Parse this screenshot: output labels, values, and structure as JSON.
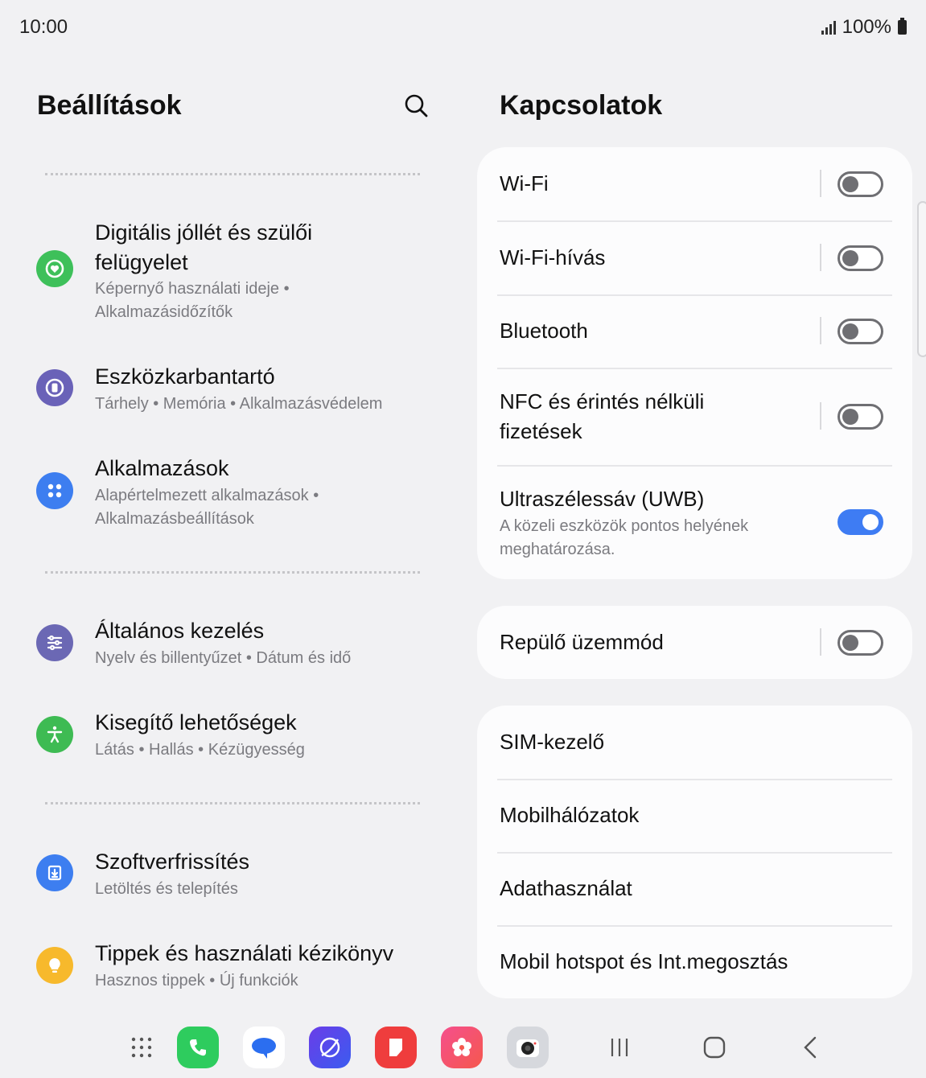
{
  "status": {
    "time": "10:00",
    "battery": "100%"
  },
  "left": {
    "title": "Beállítások",
    "items": [
      {
        "title_line1": "Digitális jóllét és szülői",
        "title_line2": "felügyelet",
        "sub_line1": "Képernyő használati ideje  •",
        "sub_line2": "Alkalmazásidőzítők",
        "icon": "heart-in-circle-icon",
        "color": "#3ec05a"
      },
      {
        "title": "Eszközkarbantartó",
        "sub": "Tárhely  •  Memória  •  Alkalmazásvédelem",
        "icon": "device-care-icon",
        "color": "#6a62b8"
      },
      {
        "title": "Alkalmazások",
        "sub_line1": "Alapértelmezett alkalmazások  •",
        "sub_line2": "Alkalmazásbeállítások",
        "icon": "apps-grid-icon",
        "color": "#3d7ef0"
      },
      {
        "title": "Általános kezelés",
        "sub": "Nyelv és billentyűzet  •  Dátum és idő",
        "icon": "sliders-icon",
        "color": "#6b68b4"
      },
      {
        "title": "Kisegítő lehetőségek",
        "sub": "Látás  •  Hallás  •  Kézügyesség",
        "icon": "accessibility-icon",
        "color": "#3ebb53"
      },
      {
        "title": "Szoftverfrissítés",
        "sub": "Letöltés és telepítés",
        "icon": "download-icon",
        "color": "#3d7ef0"
      },
      {
        "title": "Tippek és használati kézikönyv",
        "sub": "Hasznos tippek  •  Új funkciók",
        "icon": "lightbulb-icon",
        "color": "#f7b92c"
      }
    ]
  },
  "right": {
    "title": "Kapcsolatok",
    "wifi": {
      "label": "Wi-Fi",
      "on": false
    },
    "wifi_calling": {
      "label": "Wi-Fi-hívás",
      "on": false
    },
    "bluetooth": {
      "label": "Bluetooth",
      "on": false
    },
    "nfc": {
      "label_line1": "NFC és érintés nélküli",
      "label_line2": "fizetések",
      "on": false
    },
    "uwb": {
      "label": "Ultraszélessáv (UWB)",
      "sub_line1": "A közeli eszközök pontos helyének",
      "sub_line2": "meghatározása.",
      "on": true
    },
    "airplane": {
      "label": "Repülő üzemmód",
      "on": false
    },
    "sim": {
      "label": "SIM-kezelő"
    },
    "mobile_networks": {
      "label": "Mobilhálózatok"
    },
    "data_usage": {
      "label": "Adathasználat"
    },
    "hotspot": {
      "label": "Mobil hotspot és Int.megosztás"
    }
  },
  "taskbar": {
    "apps": [
      "app-drawer-icon",
      "phone-icon",
      "messages-icon",
      "internet-icon",
      "notes-icon",
      "gallery-icon",
      "camera-icon"
    ],
    "nav": [
      "recents-icon",
      "home-icon",
      "back-icon"
    ]
  },
  "colors": {
    "accent": "#3e7cf3",
    "background": "#f1f1f3",
    "card": "#fcfcfd"
  }
}
